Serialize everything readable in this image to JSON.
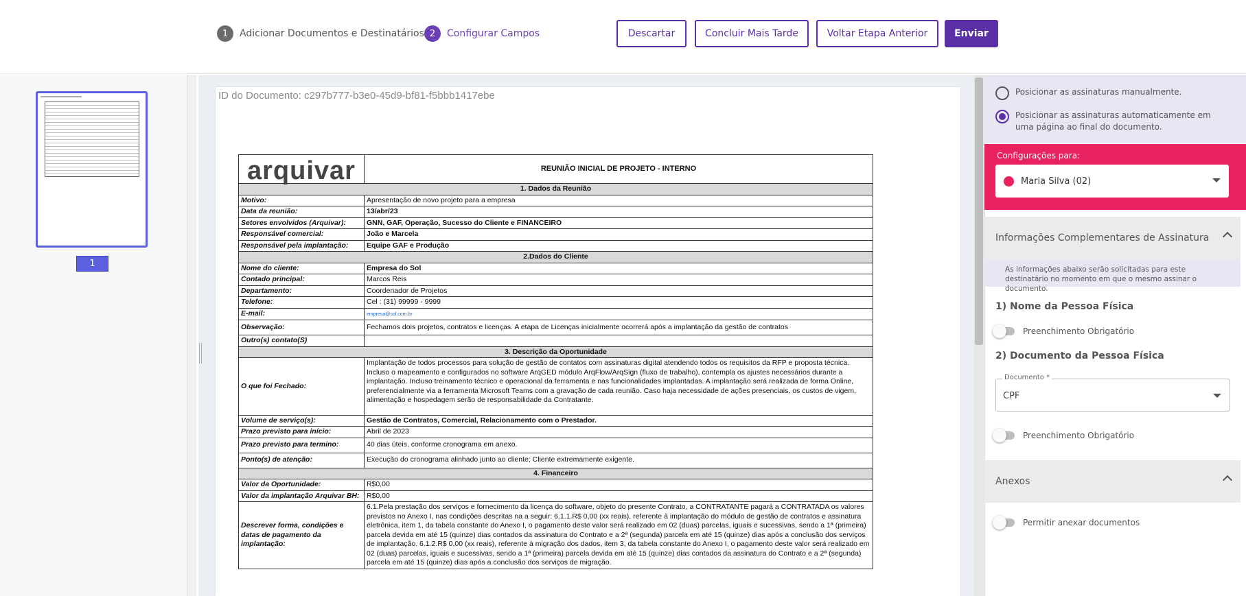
{
  "steps": [
    {
      "num": "1",
      "label": "Adicionar Documentos e Destinatários"
    },
    {
      "num": "2",
      "label": "Configurar Campos"
    }
  ],
  "buttons": {
    "discard": "Descartar",
    "later": "Concluir Mais Tarde",
    "back": "Voltar Etapa Anterior",
    "send": "Enviar"
  },
  "thumbnail": {
    "page": "1"
  },
  "document": {
    "id": "ID do Documento: c297b777-b3e0-45d9-bf81-f5bbb1417ebe",
    "logo": "arquivar",
    "title": "REUNIÃO INICIAL DE PROJETO - INTERNO",
    "sec1": "1. Dados da Reunião",
    "rows1": [
      [
        "Motivo:",
        "Apresentação de novo projeto para a empresa"
      ],
      [
        "Data da reunião:",
        "13/abr/23"
      ],
      [
        "Setores envolvidos (Arquivar):",
        "GNN, GAF, Operação, Sucesso do Cliente e FINANCEIRO"
      ],
      [
        "Responsável comercial:",
        "João e Marcela"
      ],
      [
        "Responsável pela implantação:",
        "Equipe GAF e Produção"
      ]
    ],
    "sec2": "2.Dados do Cliente",
    "rows2": [
      [
        "Nome do cliente:",
        "Empresa do Sol"
      ],
      [
        "Contado principal:",
        "Marcos Reis"
      ],
      [
        "Departamento:",
        "Coordenador de Projetos"
      ],
      [
        "Telefone:",
        "Cel : (31) 99999 - 9999"
      ],
      [
        "E-mail:",
        "empresa@sol.com.br"
      ],
      [
        "Observação:",
        "Fechamos dois projetos, contratos e licenças. A etapa de Licenças inicialmente ocorrerá após a implantação da gestão de contratos"
      ],
      [
        "Outro(s) contato(S)",
        ""
      ]
    ],
    "sec3": "3. Descrição da Oportunidade",
    "fechado_label": "O que foi Fechado:",
    "fechado_text": "Implantação de todos processos para solução de gestão de contatos com assinaturas digital atendendo todos os requisitos da RFP e proposta técnica. Incluso o mapeamento e configurados no software ArqGED módulo ArqFlow/ArqSign (fluxo de trabalho), contempla os ajustes necessários durante a implantação. Incluso treinamento técnico e operacional da ferramenta e nas funcionalidades implantadas. A implantação será realizada de forma Online, preferencialmente via a ferramenta Microsoft Teams  com a gravação de cada reunião. Caso haja necessidade de ações presenciais, os custos de vigem, alimentação e hospedagem serão de responsabilidade da Contratante.",
    "rows3": [
      [
        "Volume de serviço(s):",
        "Gestão de Contratos, Comercial, Relacionamento com o Prestador."
      ],
      [
        "Prazo previsto para início:",
        "Abril de 2023"
      ],
      [
        "Prazo previsto para termino:",
        "40 dias úteis, conforme cronograma em anexo."
      ],
      [
        "Ponto(s) de atenção:",
        "Execução do cronograma alinhado junto ao cliente;  Cliente extremamente exigente."
      ]
    ],
    "sec4": "4. Financeiro",
    "rows4": [
      [
        "Valor da Oportunidade:",
        "R$0,00"
      ],
      [
        "Valor da implantação Arquivar BH:",
        "R$0,00"
      ]
    ],
    "pag_label": "Descrever forma, condições e datas de pagamento da implantação:",
    "pag_text": "6.1.Pela prestação dos serviços e fornecimento da licença do software, objeto do presente Contrato, a CONTRATANTE pagará a CONTRATADA os valores previstos no Anexo I, nas condições descritas na a seguir: 6.1.1.R$ 0,00 (xx reais), referente à implantação do módulo de gestão de contratos e assinatura eletrônica, item 1, da tabela constante do Anexo I, o pagamento deste valor será realizado em 02 (duas) parcelas, iguais e sucessivas, sendo a 1ª (primeira) parcela devida em até 15 (quinze) dias contados da  assinatura do Contrato e a 2ª (segunda) parcela em até 15 (quinze) dias após a conclusão dos serviços de implantação. 6.1.2.R$ 0,00 (xx reais), referente à migração dos dados, item 3, da tabela constante do Anexo I, o pagamento deste valor será realizado em 02 (duas) parcelas, iguais e sucessivas, sendo a 1ª (primeira) parcela devida em até 15 (quinze) dias contados da assinatura do Contrato e a 2ª (segunda) parcela em até 15 (quinze) dias após a conclusão dos serviços de migração."
  },
  "panel": {
    "radio_manual": "Posicionar as assinaturas manualmente.",
    "radio_auto": "Posicionar as assinaturas automaticamente em uma página ao final do documento.",
    "config_label": "Configurações para:",
    "recipient": "Maria Silva (02)",
    "info_title": "Informações Complementares de Assinatura",
    "info_text": "As informações abaixo serão solicitadas para este destinatário no momento em que o mesmo assinar o documento.",
    "q1": "1) Nome da Pessoa Física",
    "q2": "2) Documento da Pessoa Física",
    "required": "Preenchimento Obrigatório",
    "doc_label": "Documento *",
    "doc_value": "CPF",
    "annex_title": "Anexos",
    "annex_toggle": "Permitir anexar documentos"
  },
  "colors": {
    "primary": "#5b2fa6",
    "accent": "#e8225f",
    "thumb": "#5b5fe0"
  }
}
